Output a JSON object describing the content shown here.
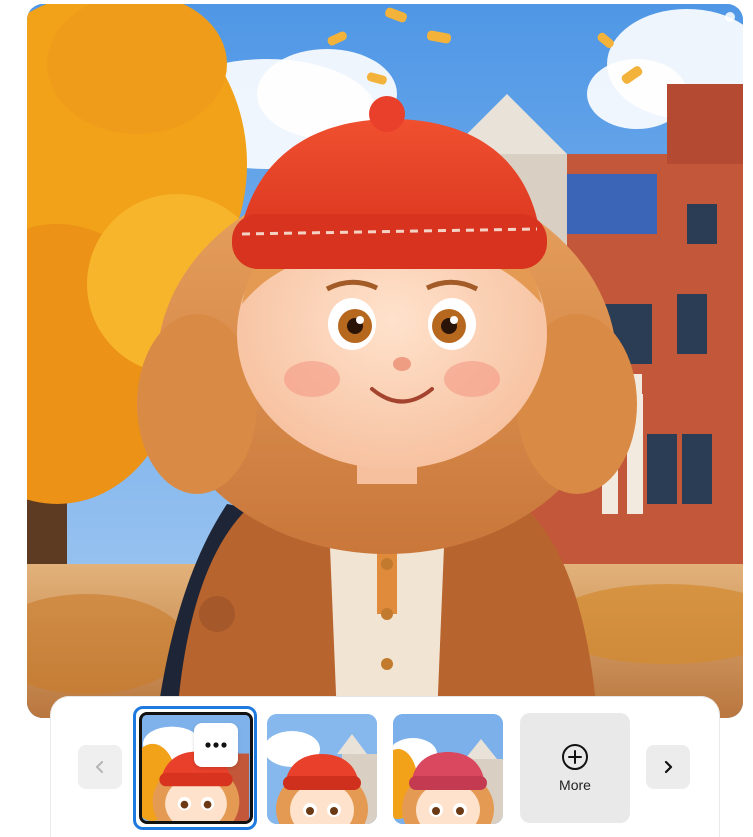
{
  "hero": {
    "icon": "generated-cartoon-girl-image"
  },
  "carousel": {
    "prev_icon": "chevron-left-icon",
    "next_icon": "chevron-right-icon",
    "thumbnails": [
      {
        "icon": "girl-thumbnail-icon",
        "selected": true
      },
      {
        "icon": "girl-thumbnail-icon",
        "selected": false
      },
      {
        "icon": "girl-thumbnail-icon",
        "selected": false
      }
    ],
    "options_icon": "more-options-dots-icon",
    "more": {
      "label": "More",
      "icon": "plus-circle-icon"
    }
  },
  "colors": {
    "selection_ring": "#1f7ae0",
    "hat_red": "#e8402b",
    "sky": "#6fa9e8",
    "foliage": "#f2a219"
  }
}
